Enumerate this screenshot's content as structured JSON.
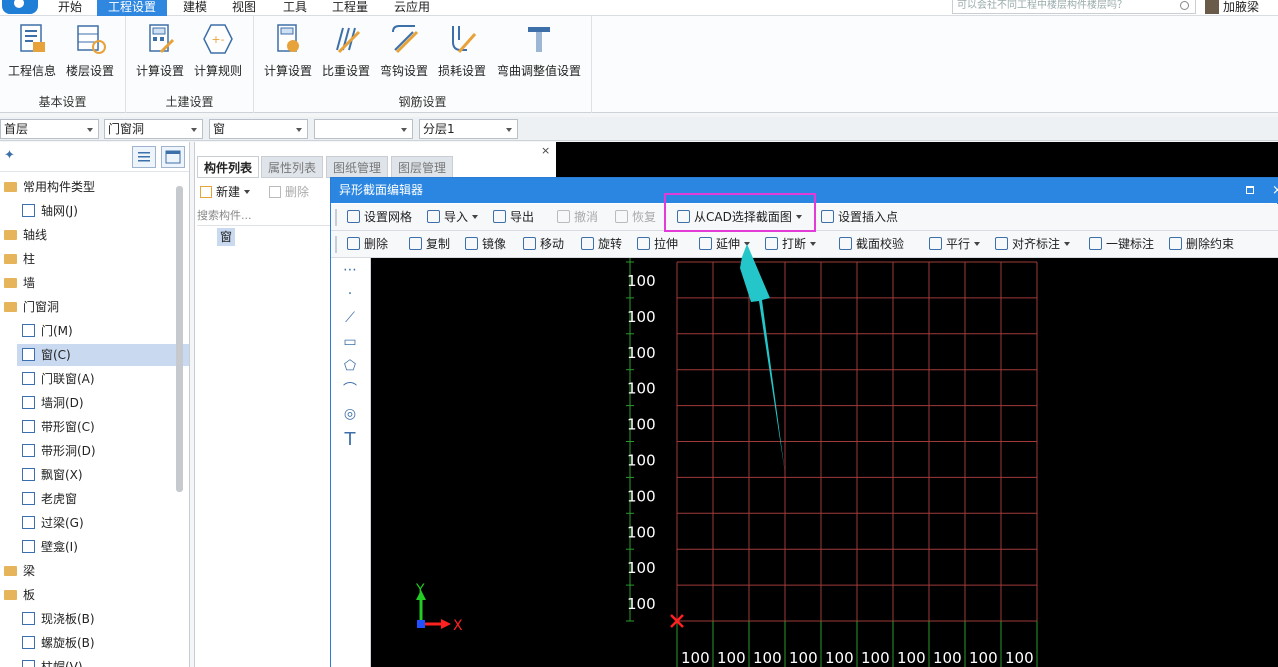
{
  "menubar": {
    "items": [
      "开始",
      "工程设置",
      "建模",
      "视图",
      "工具",
      "工程量",
      "云应用"
    ],
    "active": "工程设置",
    "search_placeholder": "可以会社不同工程中楼层构件楼层吗？",
    "user": "加腋梁"
  },
  "ribbon": {
    "groups": [
      {
        "label": "基本设置",
        "buttons": [
          "工程信息",
          "楼层设置"
        ]
      },
      {
        "label": "土建设置",
        "buttons": [
          "计算设置",
          "计算规则"
        ]
      },
      {
        "label": "钢筋设置",
        "buttons": [
          "计算设置",
          "比重设置",
          "弯钩设置",
          "损耗设置",
          "弯曲调整值设置"
        ]
      }
    ]
  },
  "selectors": [
    "首层",
    "门窗洞",
    "窗",
    "",
    "分层1"
  ],
  "tree": {
    "items": [
      {
        "label": "常用构件类型",
        "type": "folder"
      },
      {
        "label": "轴网(J)",
        "type": "child",
        "icon": "grid-icon"
      },
      {
        "label": "轴线",
        "type": "folder"
      },
      {
        "label": "柱",
        "type": "folder"
      },
      {
        "label": "墙",
        "type": "folder"
      },
      {
        "label": "门窗洞",
        "type": "folder"
      },
      {
        "label": "门(M)",
        "type": "child",
        "icon": "door-icon"
      },
      {
        "label": "窗(C)",
        "type": "child",
        "icon": "window-icon",
        "selected": true
      },
      {
        "label": "门联窗(A)",
        "type": "child",
        "icon": "door-window-icon"
      },
      {
        "label": "墙洞(D)",
        "type": "child",
        "icon": "wall-hole-icon"
      },
      {
        "label": "带形窗(C)",
        "type": "child",
        "icon": "strip-window-icon"
      },
      {
        "label": "带形洞(D)",
        "type": "child",
        "icon": "strip-hole-icon"
      },
      {
        "label": "飘窗(X)",
        "type": "child",
        "icon": "bay-window-icon"
      },
      {
        "label": "老虎窗",
        "type": "child",
        "icon": "dormer-icon"
      },
      {
        "label": "过梁(G)",
        "type": "child",
        "icon": "lintel-icon"
      },
      {
        "label": "壁龛(I)",
        "type": "child",
        "icon": "niche-icon"
      },
      {
        "label": "梁",
        "type": "folder"
      },
      {
        "label": "板",
        "type": "folder"
      },
      {
        "label": "现浇板(B)",
        "type": "child",
        "icon": "slab-icon"
      },
      {
        "label": "螺旋板(B)",
        "type": "child",
        "icon": "spiral-slab-icon"
      },
      {
        "label": "柱帽(V)",
        "type": "child",
        "icon": "column-cap-icon"
      }
    ]
  },
  "mid": {
    "tabs": [
      "构件列表",
      "属性列表",
      "图纸管理",
      "图层管理"
    ],
    "new_label": "新建",
    "delete_label": "删除",
    "search_placeholder": "搜索构件...",
    "component": "窗",
    "close": "×"
  },
  "editor": {
    "title": "异形截面编辑器",
    "toolbar1": [
      {
        "label": "设置网格",
        "icon": "grid-settings-icon"
      },
      {
        "label": "导入",
        "icon": "import-icon",
        "dropdown": true
      },
      {
        "label": "导出",
        "icon": "export-icon"
      },
      {
        "label": "撤消",
        "icon": "undo-icon",
        "disabled": true
      },
      {
        "label": "恢复",
        "icon": "redo-icon",
        "disabled": true
      },
      {
        "label": "从CAD选择截面图",
        "icon": "cad-select-icon",
        "dropdown": true
      },
      {
        "label": "设置插入点",
        "icon": "insert-point-icon"
      }
    ],
    "toolbar2": [
      {
        "label": "删除",
        "icon": "delete-icon"
      },
      {
        "label": "复制",
        "icon": "copy-icon"
      },
      {
        "label": "镜像",
        "icon": "mirror-icon"
      },
      {
        "label": "移动",
        "icon": "move-icon"
      },
      {
        "label": "旋转",
        "icon": "rotate-icon"
      },
      {
        "label": "拉伸",
        "icon": "stretch-icon"
      },
      {
        "label": "延伸",
        "icon": "extend-icon",
        "dropdown": true
      },
      {
        "label": "打断",
        "icon": "break-icon",
        "dropdown": true
      },
      {
        "label": "截面校验",
        "icon": "check-icon"
      },
      {
        "label": "平行",
        "icon": "parallel-icon",
        "dropdown": true
      },
      {
        "label": "对齐标注",
        "icon": "align-dim-icon",
        "dropdown": true
      },
      {
        "label": "一键标注",
        "icon": "auto-dim-icon"
      },
      {
        "label": "删除约束",
        "icon": "remove-constraint-icon"
      }
    ],
    "grid": {
      "row_labels": [
        "100",
        "100",
        "100",
        "100",
        "100",
        "100",
        "100",
        "100",
        "100",
        "100"
      ],
      "col_labels": [
        "100",
        "100",
        "100",
        "100",
        "100",
        "100",
        "100",
        "100",
        "100",
        "100"
      ],
      "grid_color": "#a03a3a",
      "axis_color": "#2a9a2a"
    },
    "axes": {
      "x": "X",
      "y": "Y"
    }
  },
  "colors": {
    "accent": "#2b86e2",
    "highlight": "#e23bd8",
    "arrow": "#24c6c9"
  }
}
